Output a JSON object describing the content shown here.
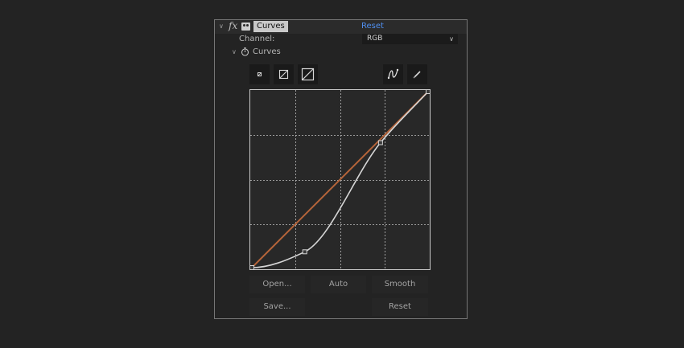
{
  "effect": {
    "fx_label": "fx",
    "name": "Curves",
    "reset_label": "Reset"
  },
  "channel": {
    "label": "Channel:",
    "selected": "RGB"
  },
  "curves_property": {
    "label": "Curves"
  },
  "tools": [
    {
      "name": "small-graph-icon"
    },
    {
      "name": "medium-graph-icon"
    },
    {
      "name": "large-graph-icon"
    },
    {
      "name": "bezier-pen-icon"
    },
    {
      "name": "pencil-icon"
    }
  ],
  "graph": {
    "grid_divisions": 4,
    "diagonal_color": "#b5643a",
    "curve_color": "#d6d6d6",
    "curve_points": [
      [
        0,
        0
      ],
      [
        0.3,
        0.09
      ],
      [
        0.73,
        0.71
      ],
      [
        1,
        1
      ]
    ]
  },
  "buttons": {
    "open": "Open...",
    "auto": "Auto",
    "smooth": "Smooth",
    "save": "Save...",
    "reset": "Reset"
  },
  "colors": {
    "link": "#4f8ff0",
    "panel_border": "#767676"
  }
}
